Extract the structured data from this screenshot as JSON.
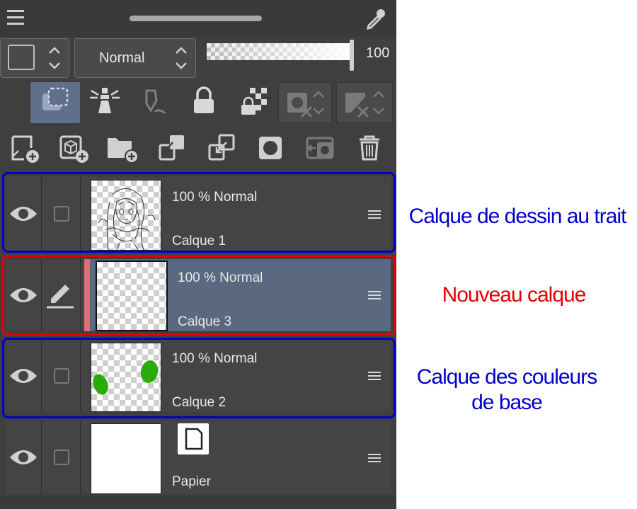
{
  "header": {
    "menu_icon": "hamburger-icon",
    "drag_handle": "drag-handle",
    "eyedropper_icon": "eyedropper-icon"
  },
  "blend": {
    "mode": "Normal",
    "opacity_value": "100",
    "opacity_level": 1.0
  },
  "toolbar_icons": [
    "clip-to-layer-below-icon",
    "reference-layer-icon",
    "draft-layer-icon",
    "lock-layer-icon",
    "lock-transparent-pixels-icon",
    "enable-mask-icon",
    "mask-ruler-icon"
  ],
  "action_icons": [
    "new-raster-layer-icon",
    "new-vector-layer-icon",
    "new-folder-icon",
    "transfer-to-lower-layer-icon",
    "combine-to-lower-layer-icon",
    "create-layer-mask-icon",
    "apply-mask-icon",
    "delete-layer-icon"
  ],
  "layers": [
    {
      "meta": "100 %  Normal",
      "name": "Calque 1"
    },
    {
      "meta": "100 %  Normal",
      "name": "Calque 3"
    },
    {
      "meta": "100 %  Normal",
      "name": "Calque 2"
    },
    {
      "name": "Papier"
    }
  ],
  "annotations": {
    "line": "Calque de dessin au trait",
    "new": "Nouveau calque",
    "base_1": "Calque des couleurs",
    "base_2": "de base"
  },
  "colors": {
    "blue": "#0000cc",
    "red": "#e60000",
    "selected_layer": "#5a6880",
    "green_paint": "#2aab0a"
  }
}
